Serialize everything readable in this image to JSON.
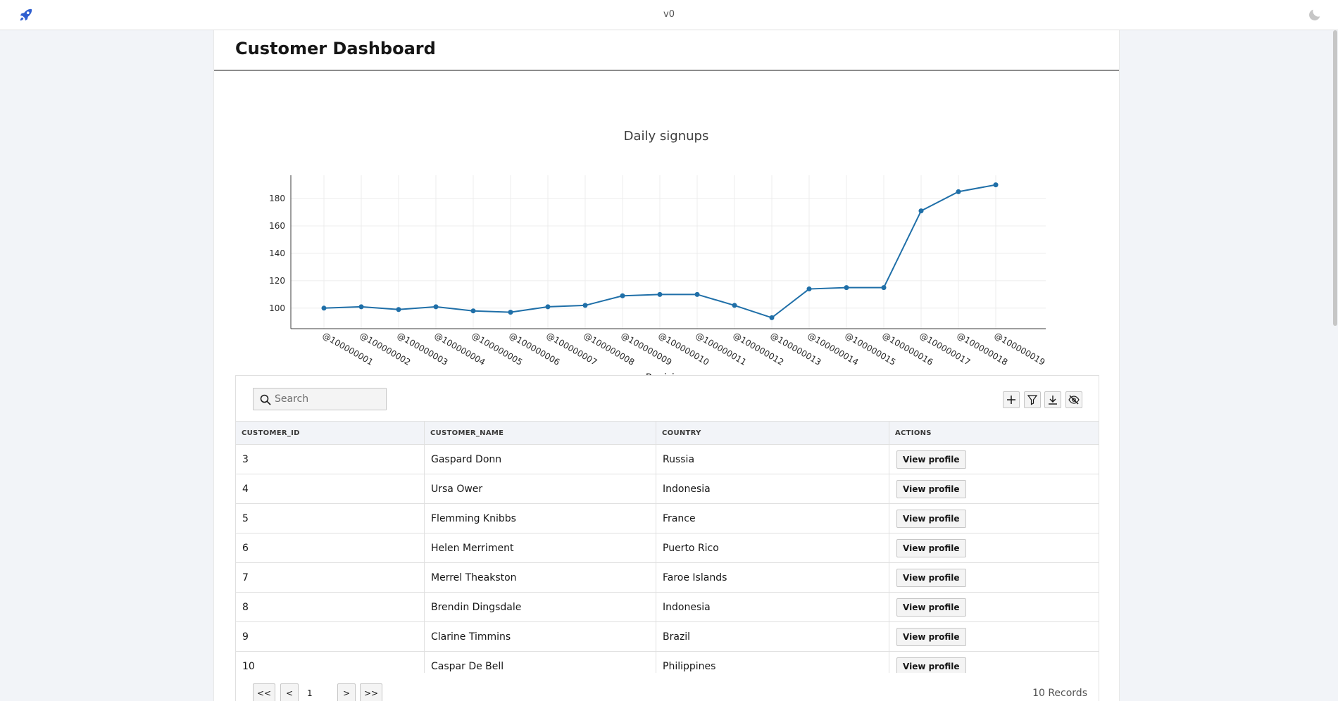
{
  "topbar": {
    "version": "v0"
  },
  "page": {
    "title": "Customer Dashboard"
  },
  "chart_data": {
    "type": "line",
    "title": "Daily signups",
    "xlabel": "Revision",
    "ylabel": "",
    "categories": [
      "@100000001",
      "@100000002",
      "@100000003",
      "@100000004",
      "@100000005",
      "@100000006",
      "@100000007",
      "@100000008",
      "@100000009",
      "@100000010",
      "@100000011",
      "@100000012",
      "@100000013",
      "@100000014",
      "@100000015",
      "@100000016",
      "@100000017",
      "@100000018",
      "@100000019"
    ],
    "values": [
      100,
      101,
      99,
      101,
      98,
      97,
      101,
      102,
      109,
      110,
      110,
      102,
      93,
      114,
      115,
      115,
      171,
      185,
      190
    ],
    "yticks": [
      100,
      120,
      140,
      160,
      180
    ],
    "ylim": [
      85,
      197
    ],
    "grid": true,
    "color": "#1f6fa8"
  },
  "table": {
    "search_placeholder": "Search",
    "columns": [
      "CUSTOMER_ID",
      "CUSTOMER_NAME",
      "COUNTRY",
      "ACTIONS"
    ],
    "rows": [
      {
        "id": "3",
        "name": "Gaspard Donn",
        "country": "Russia",
        "action": "View profile"
      },
      {
        "id": "4",
        "name": "Ursa Ower",
        "country": "Indonesia",
        "action": "View profile"
      },
      {
        "id": "5",
        "name": "Flemming Knibbs",
        "country": "France",
        "action": "View profile"
      },
      {
        "id": "6",
        "name": "Helen Merriment",
        "country": "Puerto Rico",
        "action": "View profile"
      },
      {
        "id": "7",
        "name": "Merrel Theakston",
        "country": "Faroe Islands",
        "action": "View profile"
      },
      {
        "id": "8",
        "name": "Brendin Dingsdale",
        "country": "Indonesia",
        "action": "View profile"
      },
      {
        "id": "9",
        "name": "Clarine Timmins",
        "country": "Brazil",
        "action": "View profile"
      },
      {
        "id": "10",
        "name": "Caspar De Bell",
        "country": "Philippines",
        "action": "View profile"
      }
    ],
    "pagination": {
      "first": "<<",
      "prev": "<",
      "page_info": "1 of 1",
      "next": ">",
      "last": ">>"
    },
    "records": "10 Records"
  },
  "icons": {
    "logo": "rocket-icon",
    "theme": "moon-icon",
    "search": "search-icon",
    "add": "plus-icon",
    "filter": "filter-icon",
    "download": "download-icon",
    "hide": "eye-off-icon"
  },
  "colors": {
    "accent": "#2f5fd0",
    "line": "#1f6fa8"
  }
}
